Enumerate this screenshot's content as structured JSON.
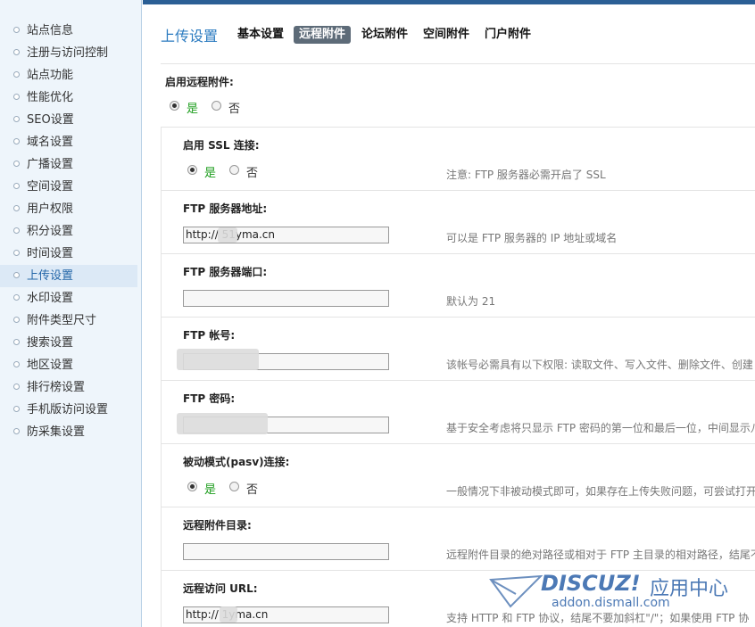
{
  "sidebar": {
    "items": [
      "站点信息",
      "注册与访问控制",
      "站点功能",
      "性能优化",
      "SEO设置",
      "域名设置",
      "广播设置",
      "空间设置",
      "用户权限",
      "积分设置",
      "时间设置",
      "上传设置",
      "水印设置",
      "附件类型尺寸",
      "搜索设置",
      "地区设置",
      "排行榜设置",
      "手机版访问设置",
      "防采集设置"
    ],
    "active": "上传设置"
  },
  "header": {
    "title": "上传设置",
    "tabs": [
      "基本设置",
      "远程附件",
      "论坛附件",
      "空间附件",
      "门户附件"
    ],
    "active_tab": "远程附件"
  },
  "form": {
    "enable_remote": {
      "label": "启用远程附件:",
      "yes": "是",
      "no": "否",
      "selected": "是"
    },
    "ssl": {
      "label": "启用 SSL 连接:",
      "yes": "是",
      "no": "否",
      "selected": "是",
      "note": "注意: FTP 服务器必需开启了 SSL"
    },
    "ftp_host": {
      "label": "FTP 服务器地址:",
      "value": "http://  51yma.cn",
      "note": "可以是 FTP 服务器的 IP 地址或域名"
    },
    "ftp_port": {
      "label": "FTP 服务器端口:",
      "value": "",
      "note": "默认为 21"
    },
    "ftp_user": {
      "label": "FTP 帐号:",
      "value": "",
      "note": "该帐号必需具有以下权限: 读取文件、写入文件、删除文件、创建"
    },
    "ftp_pass": {
      "label": "FTP 密码:",
      "value": "",
      "note": "基于安全考虑将只显示 FTP 密码的第一位和最后一位，中间显示八"
    },
    "pasv": {
      "label": "被动模式(pasv)连接:",
      "yes": "是",
      "no": "否",
      "selected": "是",
      "note": "一般情况下非被动模式即可，如果存在上传失败问题，可尝试打开"
    },
    "remote_dir": {
      "label": "远程附件目录:",
      "value": "",
      "note": "远程附件目录的绝对路径或相对于 FTP 主目录的相对路径，结尾不"
    },
    "remote_url": {
      "label": "远程访问 URL:",
      "value": "http://   1yma.cn",
      "note": "支持 HTTP 和 FTP 协议，结尾不要加斜杠\"/\"；如果使用 FTP 协"
    }
  },
  "watermark": {
    "logo": "DISCUZ!",
    "cn": "应用中心",
    "url": "addon.dismall.com"
  }
}
